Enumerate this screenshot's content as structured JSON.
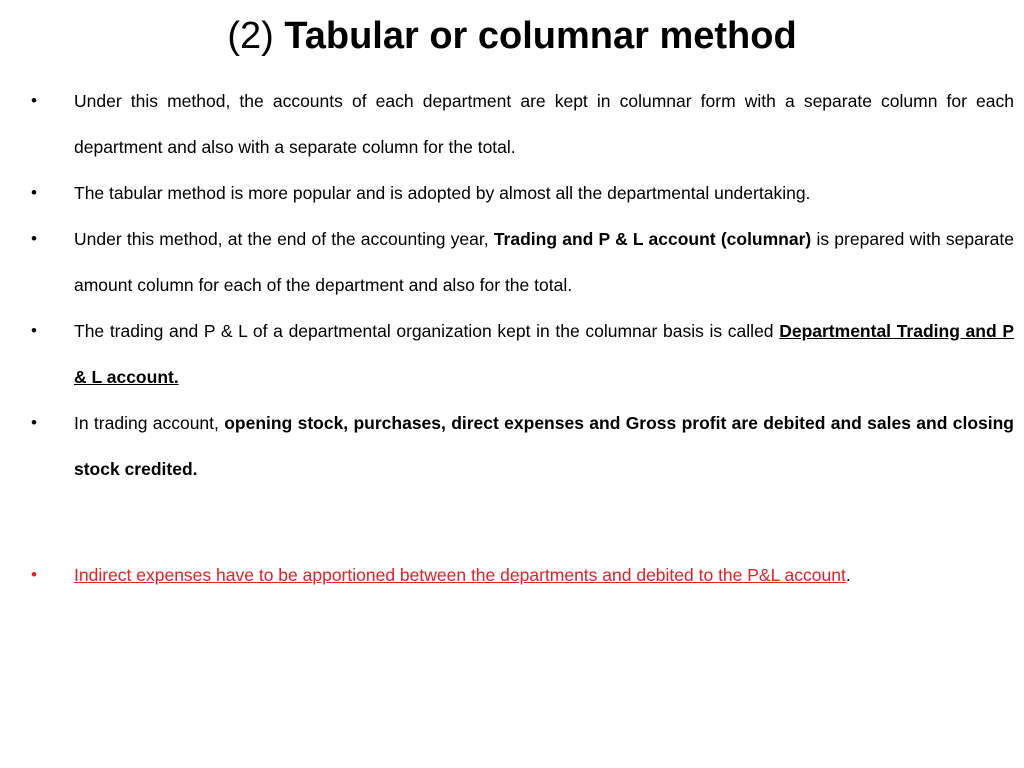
{
  "title": {
    "prefix": "(2)",
    "main": "Tabular or columnar method"
  },
  "bullets": [
    {
      "text_1": "Under this method, the accounts of each department are kept in columnar form with a separate column for each department and also with a separate column for the total."
    },
    {
      "text_1": "The tabular method is more popular and is adopted by almost all the departmental undertaking."
    },
    {
      "text_1": "Under this method, at the end of the accounting year, ",
      "bold_1": "Trading and P & L account (columnar)",
      "text_2": " is prepared with separate amount column for each of the department and also for the total."
    },
    {
      "text_1": "The trading and P & L of a departmental organization kept in the columnar basis is called ",
      "bold_underline_1": "Departmental Trading and P & L account."
    },
    {
      "text_1": " In trading account, ",
      "bold_1": "opening stock, purchases, direct expenses and Gross profit are debited and sales and closing stock credited."
    },
    {
      "red_underline_1": " Indirect expenses have to be apportioned between the departments and debited to the P&L account",
      "text_2": "."
    }
  ],
  "bullet_glyph": "•",
  "colors": {
    "text": "#000000",
    "highlight_red": "#e52222",
    "background": "#ffffff"
  }
}
